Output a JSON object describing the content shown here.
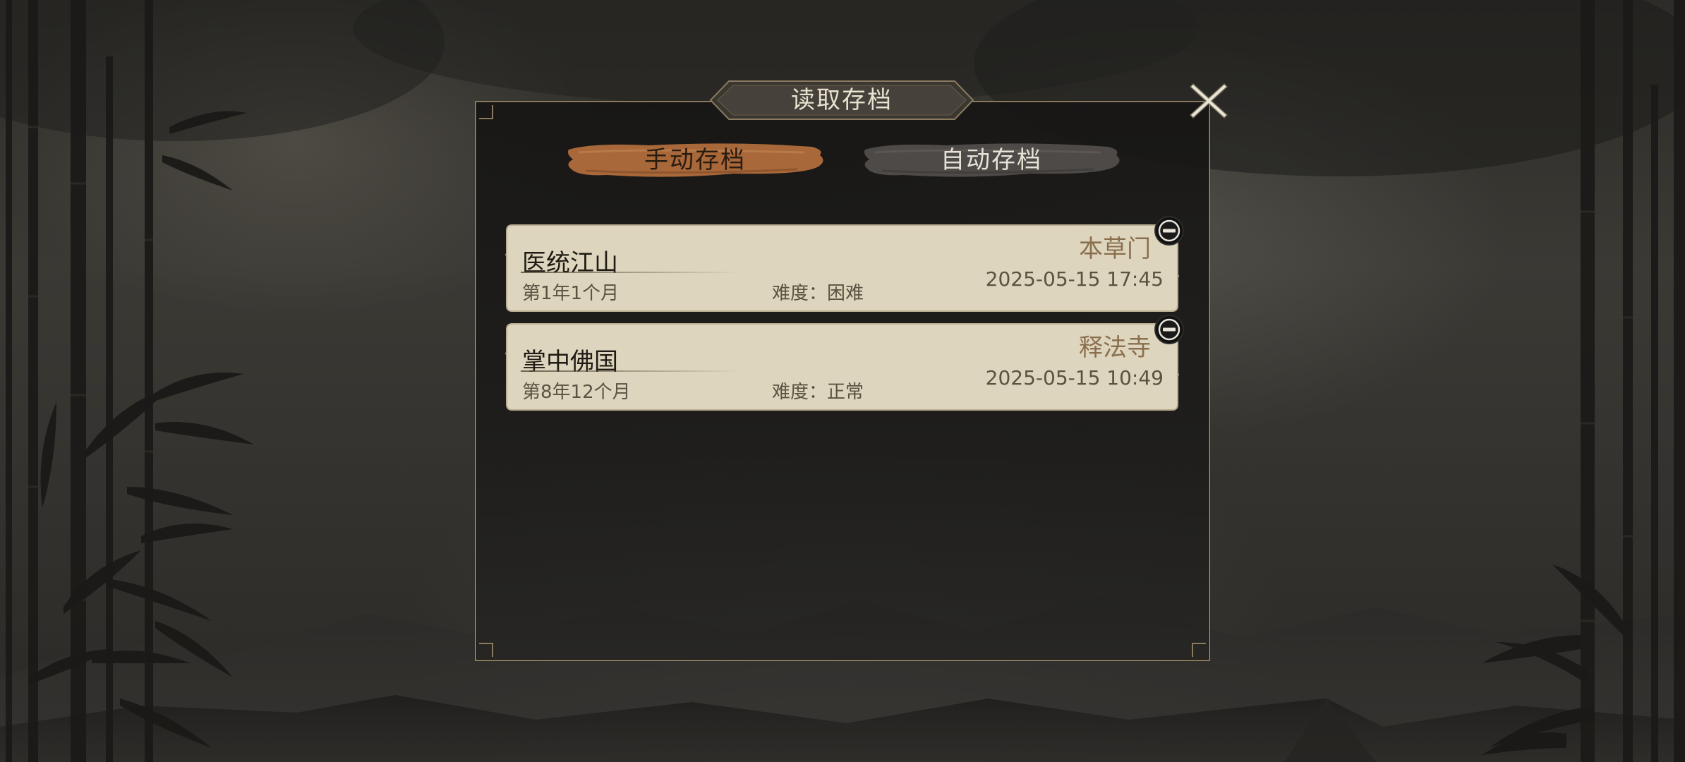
{
  "dialog": {
    "title": "读取存档"
  },
  "tabs": [
    {
      "label": "手动存档",
      "active": true
    },
    {
      "label": "自动存档",
      "active": false
    }
  ],
  "saves": [
    {
      "name": "医统江山",
      "time": "第1年1个月",
      "difficulty": "难度：困难",
      "faction": "本草门",
      "date": "2025-05-15 17:45"
    },
    {
      "name": "掌中佛国",
      "time": "第8年12个月",
      "difficulty": "难度：正常",
      "faction": "释法寺",
      "date": "2025-05-15 10:49"
    }
  ],
  "icons": {
    "close": "close-icon",
    "delete": "minus-circle-icon"
  },
  "colors": {
    "panel_border": "#8a7a5e",
    "card_bg": "#ddd5bd",
    "tab_active": "#a9683a",
    "tab_inactive": "#4e4a48",
    "faction_text": "#8a6f4e"
  }
}
